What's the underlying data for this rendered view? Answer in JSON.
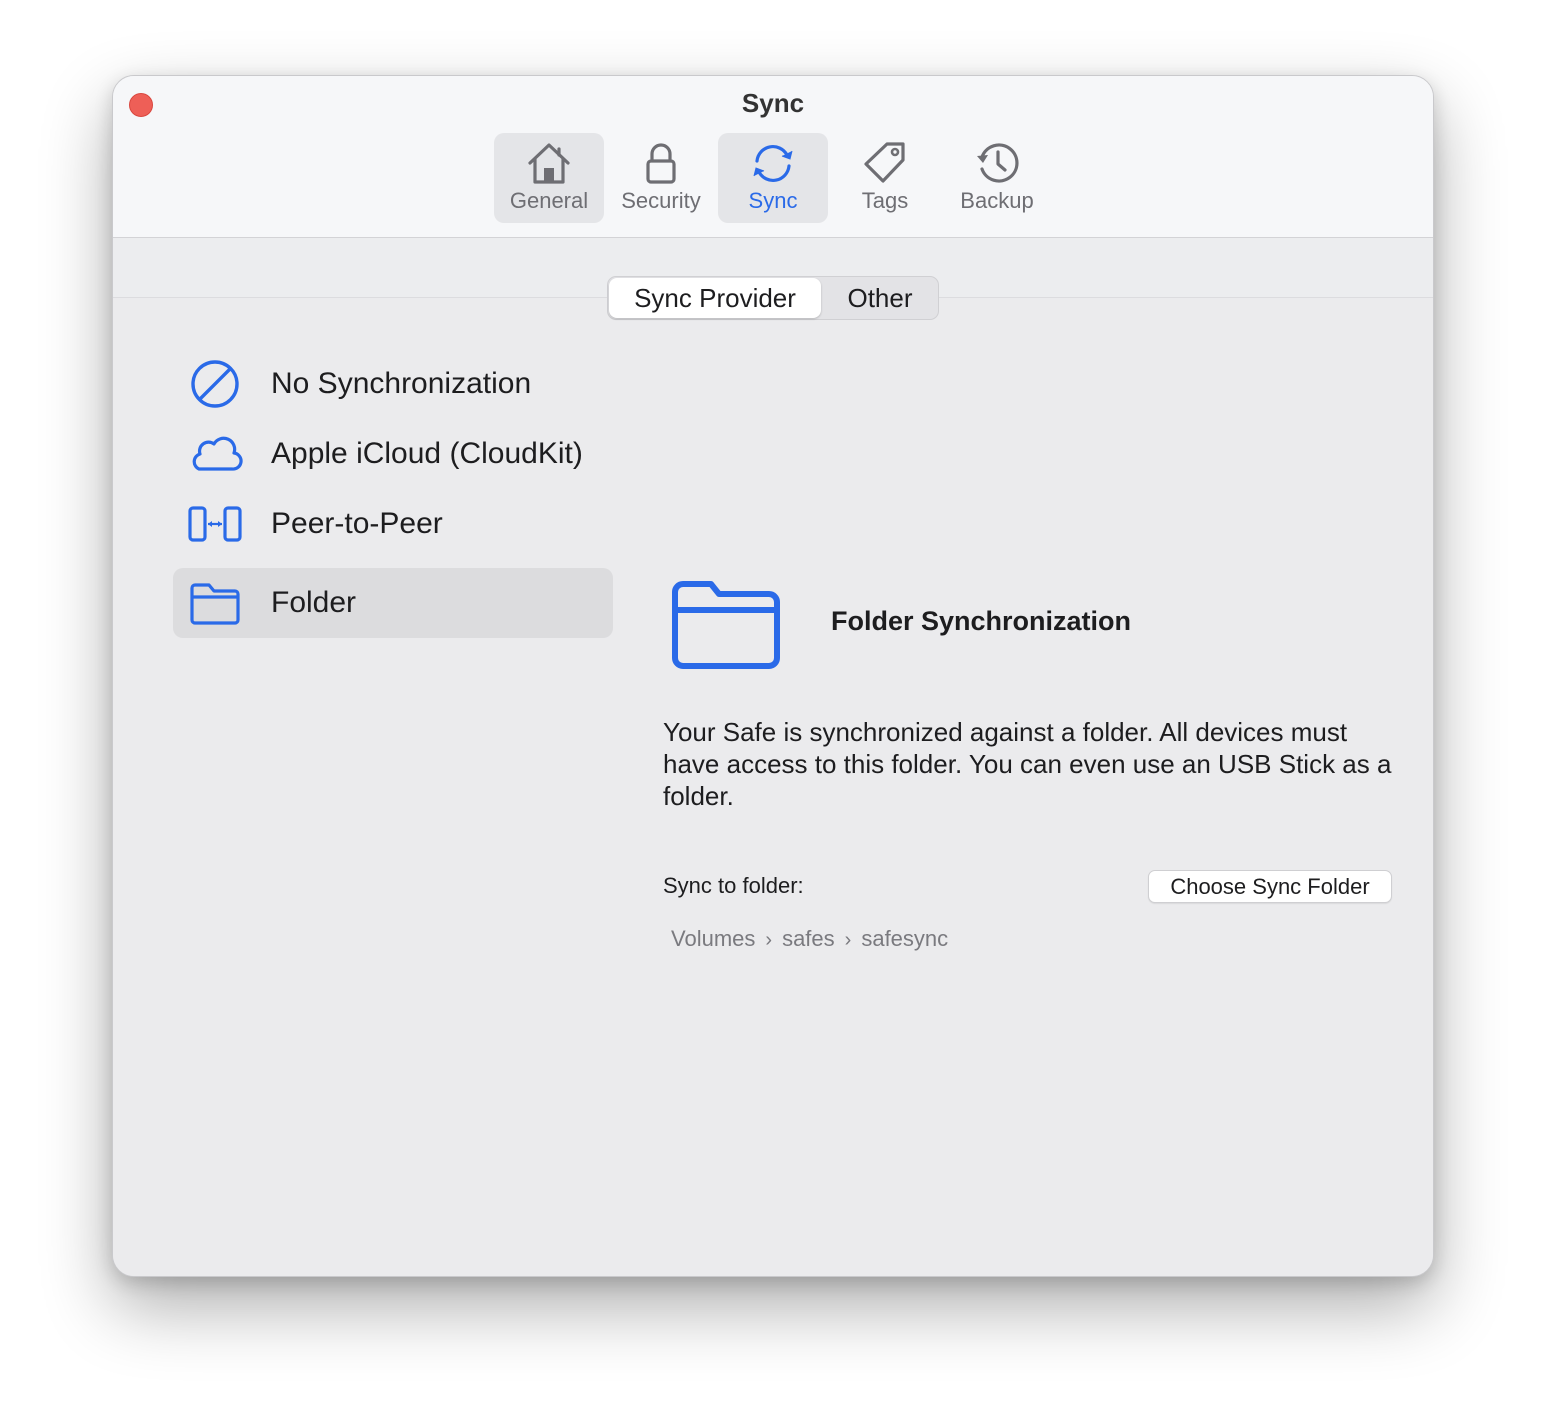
{
  "window": {
    "title": "Sync"
  },
  "toolbar": {
    "items": [
      {
        "label": "General",
        "icon": "house-icon"
      },
      {
        "label": "Security",
        "icon": "lock-icon"
      },
      {
        "label": "Sync",
        "icon": "sync-icon"
      },
      {
        "label": "Tags",
        "icon": "tag-icon"
      },
      {
        "label": "Backup",
        "icon": "clock-history-icon"
      }
    ],
    "active": "Sync",
    "accent_color": "#2a6ae8"
  },
  "segments": {
    "selected": "Sync Provider",
    "items": [
      "Sync Provider",
      "Other"
    ]
  },
  "providers": {
    "items": [
      {
        "label": "No Synchronization",
        "icon": "prohibited-icon"
      },
      {
        "label": "Apple iCloud (CloudKit)",
        "icon": "cloud-icon"
      },
      {
        "label": "Peer-to-Peer",
        "icon": "peer-to-peer-icon"
      },
      {
        "label": "Folder",
        "icon": "folder-icon"
      }
    ],
    "selected": "Folder"
  },
  "detail": {
    "title": "Folder Synchronization",
    "description": "Your Safe is synchronized  against a folder. All devices must have access to this folder. You can even use an USB Stick as a folder.",
    "sync_to_label": "Sync to folder:",
    "choose_button": "Choose Sync Folder",
    "path": [
      "Volumes",
      "safes",
      "safesync"
    ],
    "path_separator": "›"
  }
}
